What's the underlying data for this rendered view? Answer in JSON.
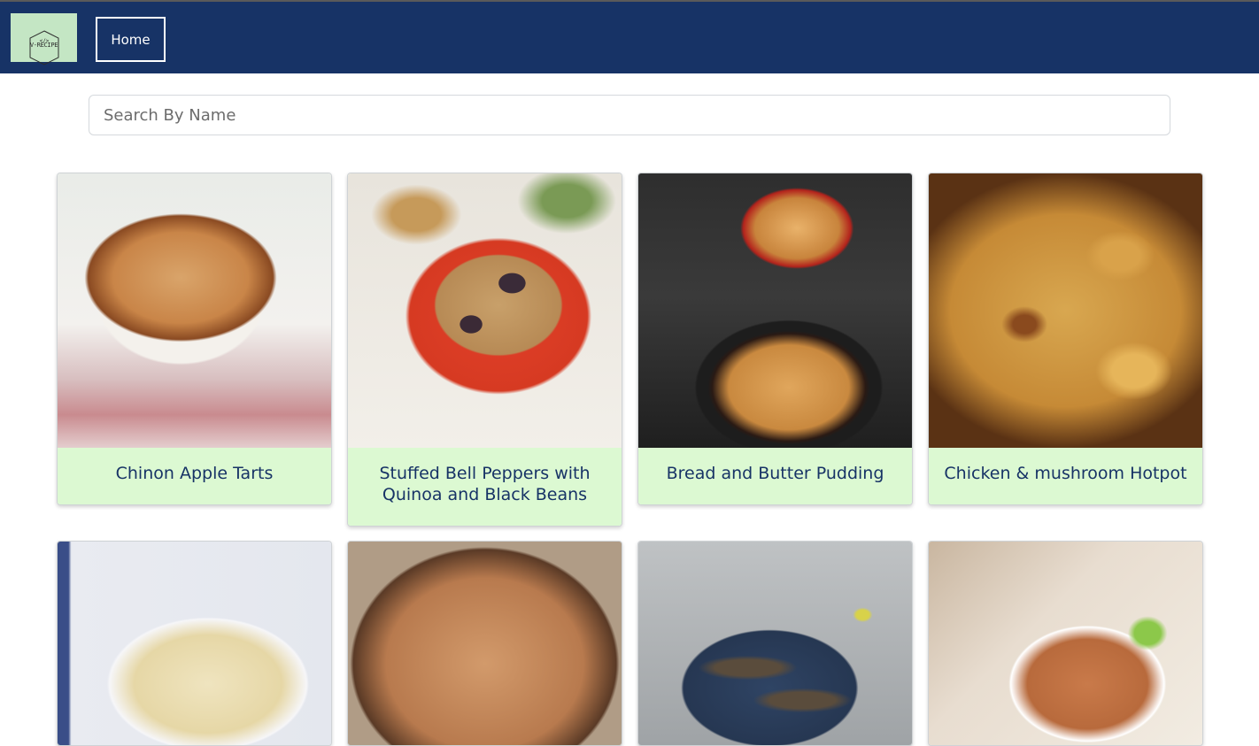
{
  "nav": {
    "logo_text": "V-RECIPE",
    "home_label": "Home"
  },
  "search": {
    "placeholder": "Search By Name",
    "value": ""
  },
  "recipes": [
    {
      "title": "Chinon Apple Tarts"
    },
    {
      "title": "Stuffed Bell Peppers with Quinoa and Black Beans"
    },
    {
      "title": "Bread and Butter Pudding"
    },
    {
      "title": "Chicken & mushroom Hotpot"
    },
    {
      "title": ""
    },
    {
      "title": ""
    },
    {
      "title": ""
    },
    {
      "title": ""
    }
  ],
  "colors": {
    "navbar": "#173366",
    "caption_bg": "#dcf9d2",
    "caption_text": "#173366",
    "logo_bg": "#c4e6c4"
  }
}
